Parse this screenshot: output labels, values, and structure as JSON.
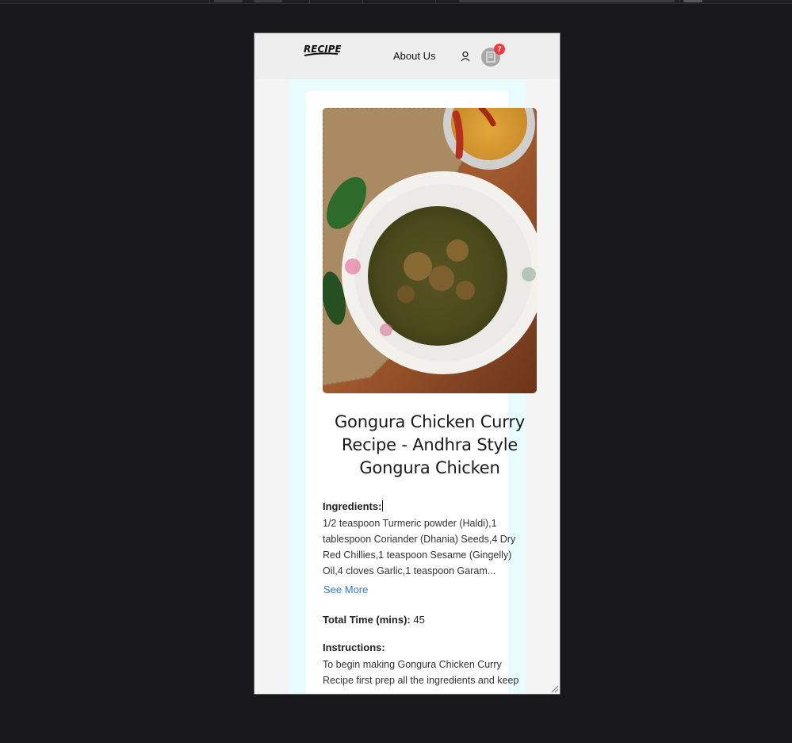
{
  "header": {
    "logo_text": "RECIPE",
    "about_label": "About Us",
    "cart_count": "7",
    "icons": {
      "user": "user-icon",
      "cart": "document-icon"
    }
  },
  "recipe": {
    "image_alt": "Gongura Chicken Curry",
    "title": "Gongura Chicken Curry Recipe - Andhra Style Gongura Chicken",
    "ingredients_label": "Ingredients:",
    "ingredients_text": "1/2 teaspoon Turmeric powder (Haldi),1 tablespoon Coriander (Dhania) Seeds,4 Dry Red Chillies,1 teaspoon Sesame (Gingelly) Oil,4 cloves Garlic,1 teaspoon Garam...",
    "see_more_label": "See More",
    "total_time_label": "Total Time (mins):",
    "total_time_value": "45",
    "instructions_label": "Instructions:",
    "instructions_text": "To begin making Gongura Chicken Curry Recipe first prep all the ingredients and keep"
  },
  "colors": {
    "link": "#2c7be5",
    "badge": "#ef3b3b",
    "content_bg": "#e9fcfd",
    "page_bg": "#18181a"
  }
}
